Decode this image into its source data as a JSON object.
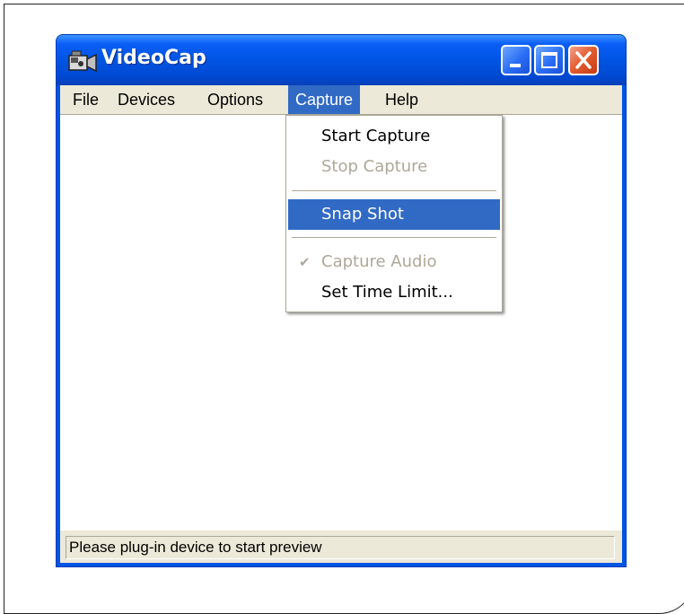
{
  "window": {
    "title": "VideoCap",
    "app_icon": "camcorder-icon"
  },
  "title_buttons": {
    "minimize": "minimize-icon",
    "maximize": "maximize-icon",
    "close": "close-icon"
  },
  "menubar": {
    "items": [
      {
        "label": "File"
      },
      {
        "label": "Devices"
      },
      {
        "label": "Options"
      },
      {
        "label": "Capture"
      },
      {
        "label": "Help"
      }
    ],
    "active": "Capture"
  },
  "capture_menu": {
    "items": [
      {
        "label": "Start Capture",
        "enabled": true
      },
      {
        "label": "Stop Capture",
        "enabled": false
      },
      {
        "label": "Snap Shot",
        "enabled": true,
        "highlighted": true
      },
      {
        "label": "Capture Audio",
        "enabled": false,
        "checked": true
      },
      {
        "label": "Set Time Limit...",
        "enabled": true
      }
    ]
  },
  "statusbar": {
    "text": "Please plug-in device to start preview"
  },
  "colors": {
    "titlebar": "#0054e3",
    "menu_highlight": "#316ac5",
    "disabled_text": "#aca899",
    "menubar_bg": "#ece9d8"
  }
}
